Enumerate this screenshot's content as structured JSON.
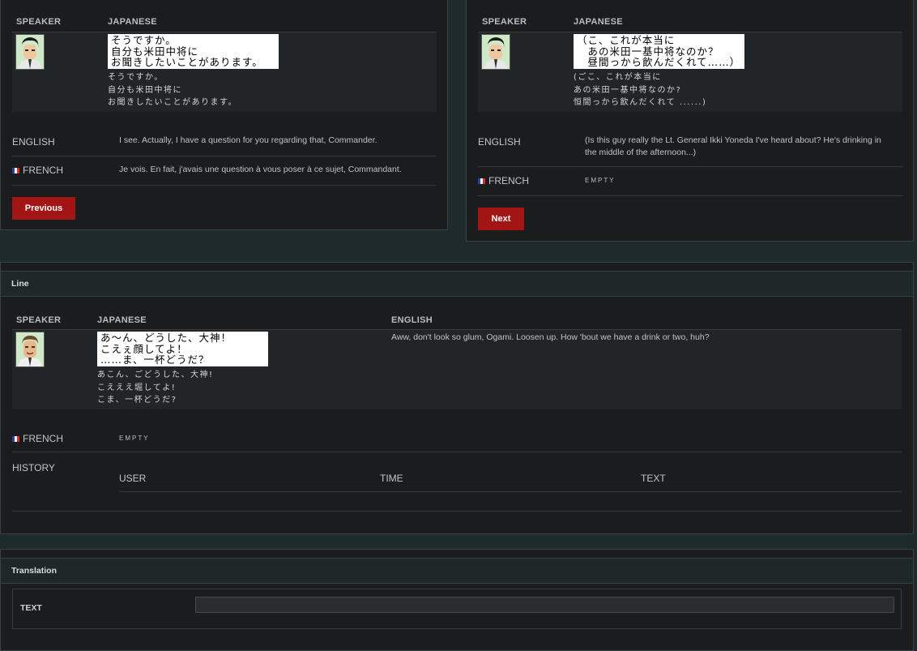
{
  "headers": {
    "speaker": "SPEAKER",
    "japanese": "JAPANESE",
    "english": "ENGLISH"
  },
  "prev_card": {
    "jp_box": "そうですか。\n自分も米田中将に\nお聞きしたいことがあります。",
    "jp_text": "そうですか。\n自分も米田中将に\nお聞きしたいことがあります。",
    "english_label": "ENGLISH",
    "english_value": "I see. Actually, I have a question for you regarding that, Commander.",
    "french_label": "FRENCH",
    "french_value": "Je vois. En fait, j'avais une question à vous poser à ce sujet, Commandant.",
    "button": "Previous"
  },
  "next_card": {
    "jp_box": "（こ、これが本当に\n　あの米田一基中将なのか？\n　昼間っから飲んだくれて……）",
    "jp_text": "(ごこ、これが本当に\nあの米田一基中将なのか?\n恒間っから飲んだくれて ......)",
    "english_label": "ENGLISH",
    "english_value": "(Is this guy really the Lt. General Ikki Yoneda I've heard about? He's drinking in the middle of the afternoon...)",
    "french_label": "FRENCH",
    "french_value": "EMPTY",
    "button": "Next"
  },
  "line_section": {
    "title": "Line",
    "jp_box": "あ～ん、どうした、大神！\nこえぇ顔してよ！\n……ま、一杯どうだ？",
    "jp_text": "あこん、ごどうした、大神!\nこえええ堀してよ!\nこま、一杯どうだ?",
    "english_value": "Aww, don't look so glum, Ogami. Loosen up. How 'bout we have a drink or two, huh?",
    "french_label": "FRENCH",
    "french_value": "EMPTY",
    "history_label": "HISTORY",
    "history_columns": [
      "USER",
      "TIME",
      "TEXT"
    ]
  },
  "translation_section": {
    "title": "Translation",
    "text_label": "TEXT",
    "text_value": ""
  },
  "colors": {
    "accent": "#a31414",
    "background": "#1e2a2c",
    "panel": "#1b1c1e"
  },
  "icons": {
    "flag": "france-flag-icon",
    "avatar_young": "officer-portrait-icon",
    "avatar_old": "general-portrait-icon"
  }
}
